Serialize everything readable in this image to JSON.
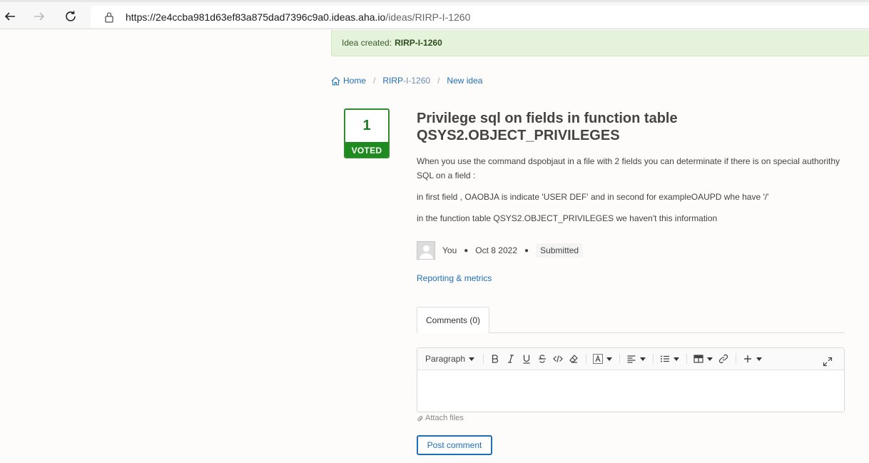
{
  "browser": {
    "url_host": "https://2e4ccba981d63ef83a875dad7396c9a0.ideas.aha.io",
    "url_path": "/ideas/RIRP-I-1260"
  },
  "flash": {
    "prefix": "Idea created:",
    "ref": "RIRP-I-1260"
  },
  "breadcrumb": {
    "home": "Home",
    "ref_prefix": "RIRP",
    "ref_suffix": "-I-1260",
    "current": "New idea"
  },
  "vote": {
    "count": "1",
    "label": "VOTED"
  },
  "idea": {
    "title": "Privilege sql on fields in function table QSYS2.OBJECT_PRIVILEGES",
    "paragraphs": [
      "When you use the command dspobjaut in a file with 2 fields you can determinate if there is on special authorithy SQL on a field :",
      "in first field , OAOBJA is indicate 'USER DEF' and in second for exampleOAUPD whe have '/'",
      "in the function table QSYS2.OBJECT_PRIVILEGES we haven't this information"
    ],
    "author": "You",
    "date": "Oct 8 2022",
    "status": "Submitted"
  },
  "links": {
    "reporting": "Reporting & metrics"
  },
  "comments": {
    "tab_label": "Comments (0)",
    "paragraph_label": "Paragraph",
    "attach_label": "Attach files",
    "post_label": "Post comment"
  }
}
